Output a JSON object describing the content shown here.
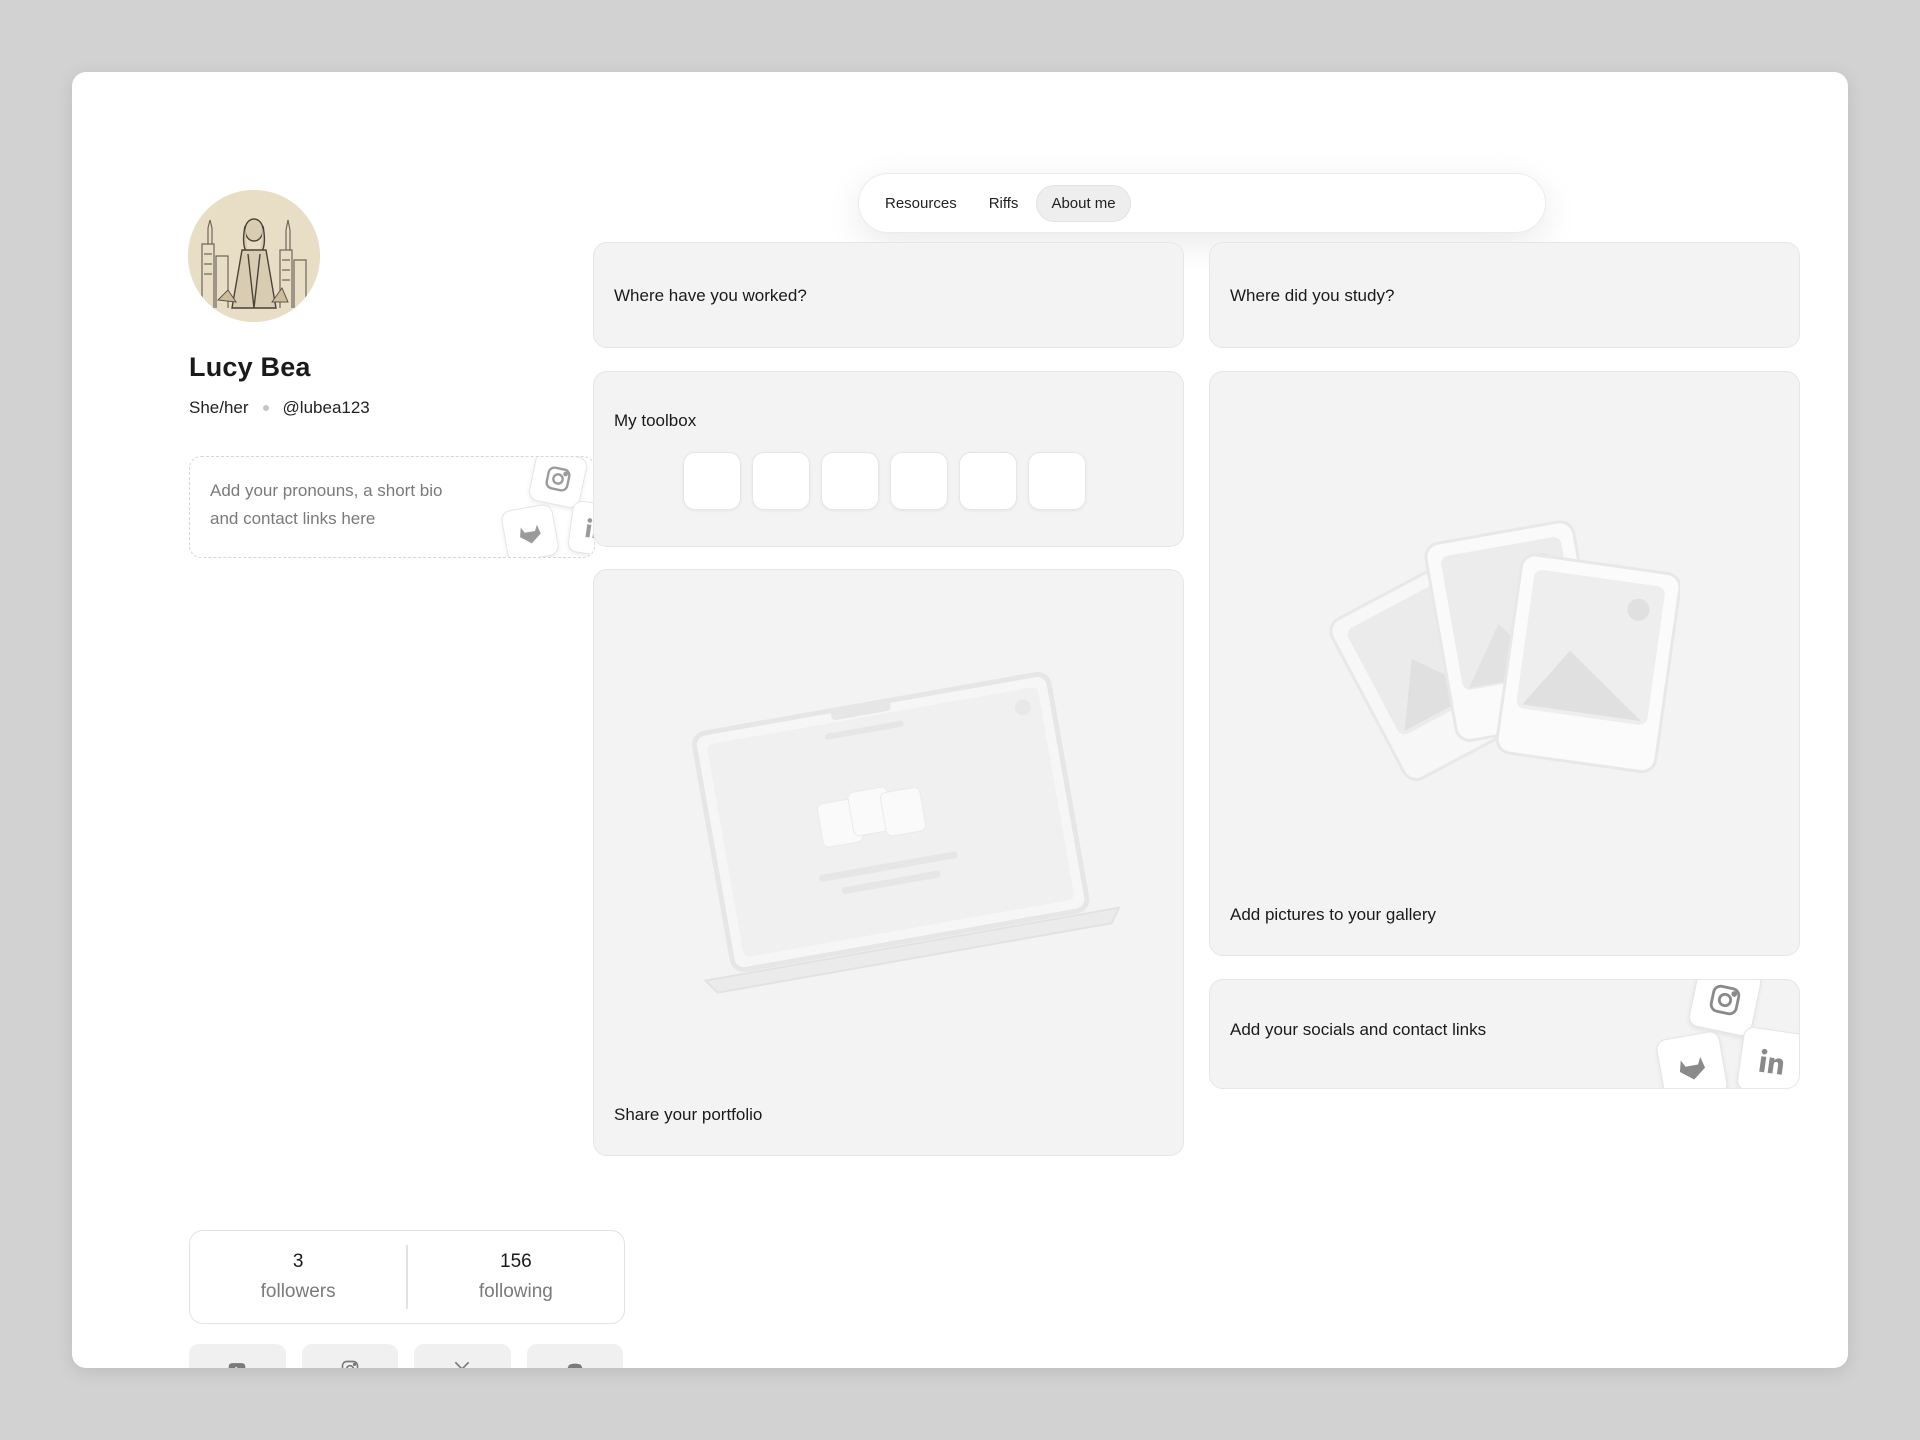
{
  "profile": {
    "name": "Lucy Bea",
    "pronouns": "She/her",
    "handle": "@lubea123",
    "bio_placeholder": "Add your pronouns, a short bio and contact links here"
  },
  "stats": {
    "followers_count": "3",
    "followers_label": "followers",
    "following_count": "156",
    "following_label": "following"
  },
  "social_buttons": [
    "youtube-icon",
    "instagram-icon",
    "x-icon",
    "discord-icon"
  ],
  "nav": {
    "items": [
      {
        "label": "Resources",
        "active": false
      },
      {
        "label": "Riffs",
        "active": false
      },
      {
        "label": "About me",
        "active": true
      }
    ]
  },
  "cards": {
    "work": "Where have you worked?",
    "study": "Where did you study?",
    "toolbox": "My toolbox",
    "gallery": "Add pictures to your gallery",
    "portfolio": "Share your portfolio",
    "socials": "Add your socials and contact links"
  },
  "colors": {
    "page_bg": "#d2d2d2",
    "card_bg": "#f3f3f3",
    "muted_text": "#7a7a7a"
  }
}
